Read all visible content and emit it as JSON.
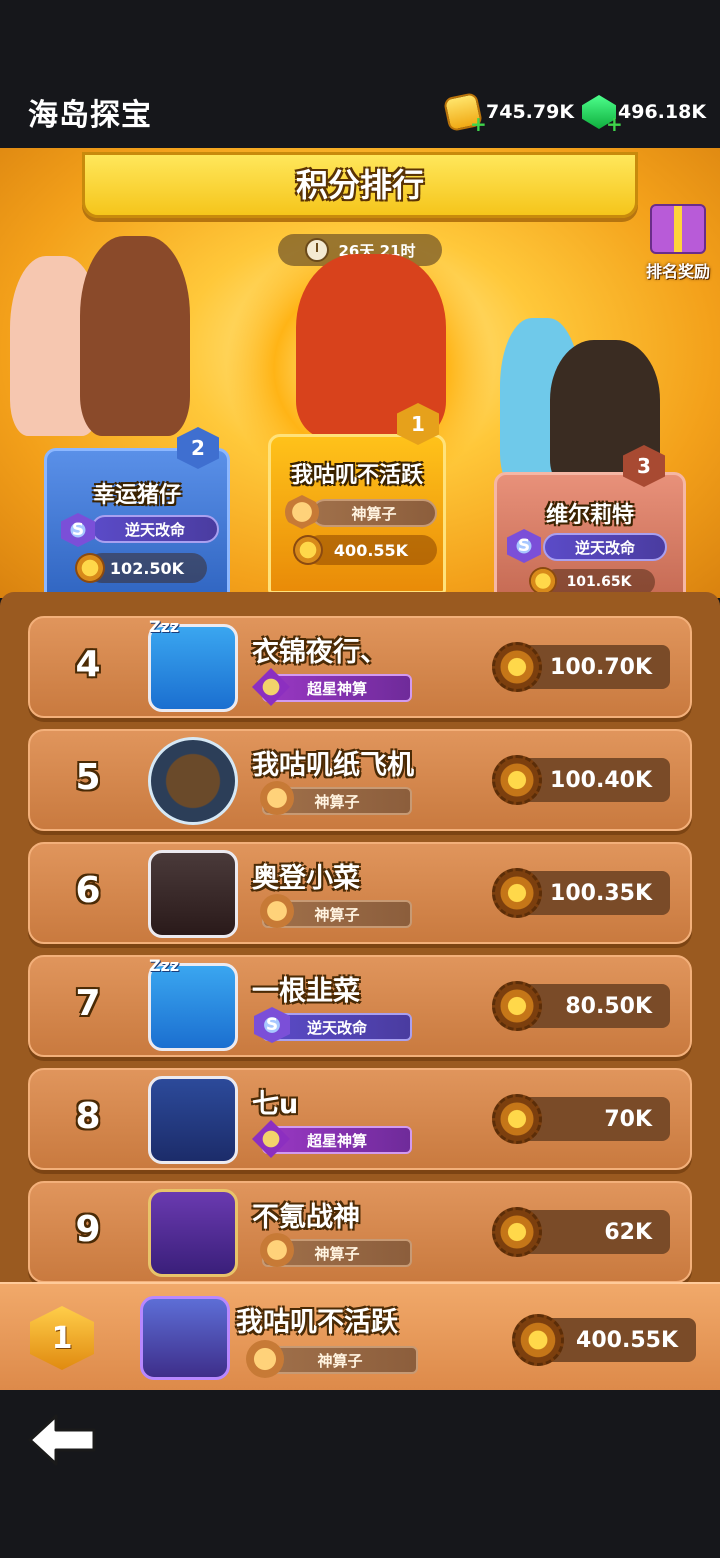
{
  "header": {
    "title": "海岛探宝",
    "coins": "745.79K",
    "gems": "496.18K"
  },
  "banner": {
    "title": "积分排行",
    "timer": "26天 21时",
    "reward_label": "排名奖励"
  },
  "podium": [
    {
      "rank": "2",
      "name": "幸运猪仔",
      "title": "逆天改命",
      "title_icon": "S",
      "score": "102.50K"
    },
    {
      "rank": "1",
      "name": "我咕叽不活跃",
      "title": "神算子",
      "title_icon": "thumbs-up-icon",
      "score": "400.55K"
    },
    {
      "rank": "3",
      "name": "维尔莉特",
      "title": "逆天改命",
      "title_icon": "S",
      "score": "101.65K"
    }
  ],
  "rankings": [
    {
      "rank": "4",
      "name": "衣锦夜行、",
      "title": "超星神算",
      "style": "purple",
      "score": "100.70K",
      "avatar_badge": "Zzz"
    },
    {
      "rank": "5",
      "name": "我咕叽纸飞机",
      "title": "神算子",
      "style": "brown",
      "score": "100.40K",
      "avatar_badge": ""
    },
    {
      "rank": "6",
      "name": "奥登小菜",
      "title": "神算子",
      "style": "brown",
      "score": "100.35K",
      "avatar_badge": ""
    },
    {
      "rank": "7",
      "name": "一根韭菜",
      "title": "逆天改命",
      "style": "indigo",
      "score": "80.50K",
      "avatar_badge": "Zzz"
    },
    {
      "rank": "8",
      "name": "七u",
      "title": "超星神算",
      "style": "purple",
      "score": "70K",
      "avatar_badge": ""
    },
    {
      "rank": "9",
      "name": "不氪战神",
      "title": "神算子",
      "style": "brown",
      "score": "62K",
      "avatar_badge": ""
    }
  ],
  "my_entry": {
    "rank": "1",
    "name": "我咕叽不活跃",
    "title": "神算子",
    "score": "400.55K"
  },
  "icons": {
    "back": "back-arrow-icon",
    "coin": "gold-coin-icon",
    "gem": "green-gem-icon",
    "gift": "gift-box-icon",
    "clock": "clock-icon"
  },
  "colors": {
    "banner": "#f5c51b",
    "row": "#d88a4f",
    "score_box": "#7a4b28"
  }
}
